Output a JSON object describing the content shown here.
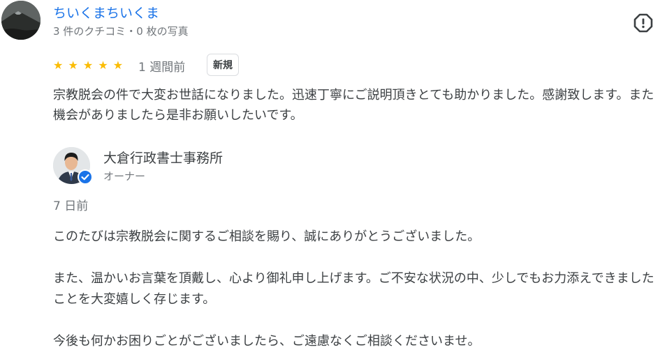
{
  "review": {
    "reviewer_name": "ちいくまちいくま",
    "reviewer_meta": "3 件のクチコミ・0 枚の写真",
    "rating": 5,
    "star_glyph": "★",
    "time": "1 週間前",
    "badge": "新規",
    "text": "宗教脱会の件で大変お世話になりました。迅速丁寧にご説明頂きとても助かりました。感謝致します。また機会がありましたら是非お願いしたいです。"
  },
  "owner_reply": {
    "owner_name": "大倉行政書士事務所",
    "owner_role": "オーナー",
    "time": "7 日前",
    "paragraphs": [
      "このたびは宗教脱会に関するご相談を賜り、誠にありがとうございました。",
      "また、温かいお言葉を頂戴し、心より御礼申し上げます。ご不安な状況の中、少しでもお力添えできましたことを大変嬉しく存じます。",
      "今後も何かお困りごとがございましたら、ご遠慮なくご相談くださいませ。"
    ]
  },
  "colors": {
    "link": "#1a73e8",
    "star": "#fbbc04",
    "text": "#3c4043",
    "secondary": "#70757a"
  },
  "icons": {
    "flag": "report-flag-icon",
    "verified": "verified-check-icon"
  }
}
